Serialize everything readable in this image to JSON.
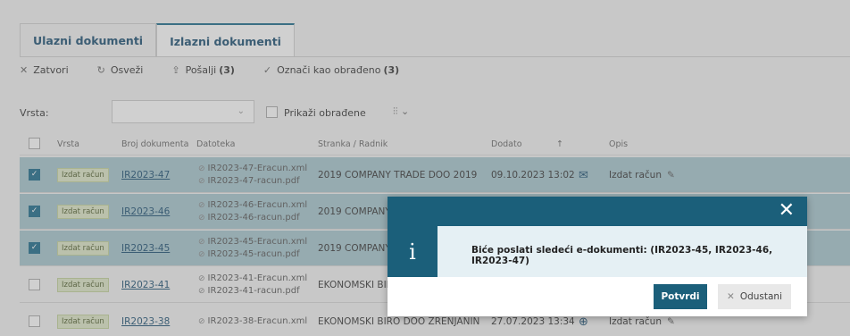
{
  "tabs": [
    {
      "label": "Ulazni dokumenti",
      "active": false
    },
    {
      "label": "Izlazni dokumenti",
      "active": true
    }
  ],
  "toolbar": {
    "close_label": "Zatvori",
    "refresh_label": "Osveži",
    "send_label": "Pošalji",
    "send_count": "(3)",
    "mark_label": "Označi kao obrađeno",
    "mark_count": "(3)"
  },
  "filters": {
    "type_label": "Vrsta:",
    "type_value": "",
    "show_processed_label": "Prikaži obrađene"
  },
  "table": {
    "headers": {
      "type": "Vrsta",
      "doc_no": "Broj dokumenta",
      "file": "Datoteka",
      "party": "Stranka / Radnik",
      "added": "Dodato",
      "sort_arrow": "↑",
      "desc": "Opis"
    },
    "rows": [
      {
        "selected": true,
        "type": "Izdat račun",
        "doc_no": "IR2023-47",
        "file1": "IR2023-47-Eracun.xml",
        "file2": "IR2023-47-racun.pdf",
        "party": "2019 COMPANY TRADE DOO 2019",
        "added": "09.10.2023 13:02",
        "desc": "Izdat račun"
      },
      {
        "selected": true,
        "type": "Izdat račun",
        "doc_no": "IR2023-46",
        "file1": "IR2023-46-Eracun.xml",
        "file2": "IR2023-46-racun.pdf",
        "party": "2019 COMPANY T",
        "added": "",
        "desc": ""
      },
      {
        "selected": true,
        "type": "Izdat račun",
        "doc_no": "IR2023-45",
        "file1": "IR2023-45-Eracun.xml",
        "file2": "IR2023-45-racun.pdf",
        "party": "2019 COMPANY T",
        "added": "",
        "desc": ""
      },
      {
        "selected": false,
        "type": "Izdat račun",
        "doc_no": "IR2023-41",
        "file1": "IR2023-41-Eracun.xml",
        "file2": "IR2023-41-racun.pdf",
        "party": "EKONOMSKI BIR",
        "added": "",
        "desc": ""
      },
      {
        "selected": false,
        "type": "Izdat račun",
        "doc_no": "IR2023-38",
        "file1": "IR2023-38-Eracun.xml",
        "file2": "",
        "party": "EKONOMSKI BIRO DOO ZRENJANIN",
        "added": "27.07.2023 13:34",
        "desc": "Izdat račun"
      }
    ]
  },
  "modal": {
    "info_glyph": "i",
    "message": "Biće poslati sledeći e-dokumenti: (IR2023-45, IR2023-46, IR2023-47)",
    "confirm_label": "Potvrdi",
    "cancel_label": "Odustani"
  }
}
